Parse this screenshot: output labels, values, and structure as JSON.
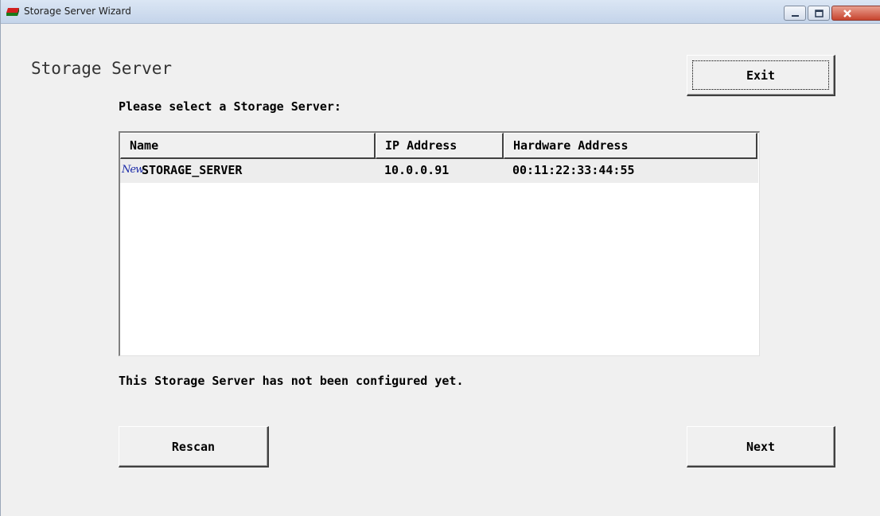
{
  "window": {
    "title": "Storage Server Wizard"
  },
  "page": {
    "heading": "Storage Server",
    "prompt": "Please select a Storage Server:",
    "status": "This Storage Server has not been configured yet."
  },
  "buttons": {
    "exit": "Exit",
    "rescan": "Rescan",
    "next": "Next"
  },
  "table": {
    "columns": [
      "Name",
      "IP Address",
      "Hardware Address"
    ],
    "rows": [
      {
        "badge": "New",
        "name": "STORAGE_SERVER",
        "ip": "10.0.0.91",
        "hw": "00:11:22:33:44:55"
      }
    ]
  },
  "colors": {
    "window_bg": "#f0f0f0",
    "selected_row": "#ededed",
    "new_badge": "#1a2aa8"
  }
}
